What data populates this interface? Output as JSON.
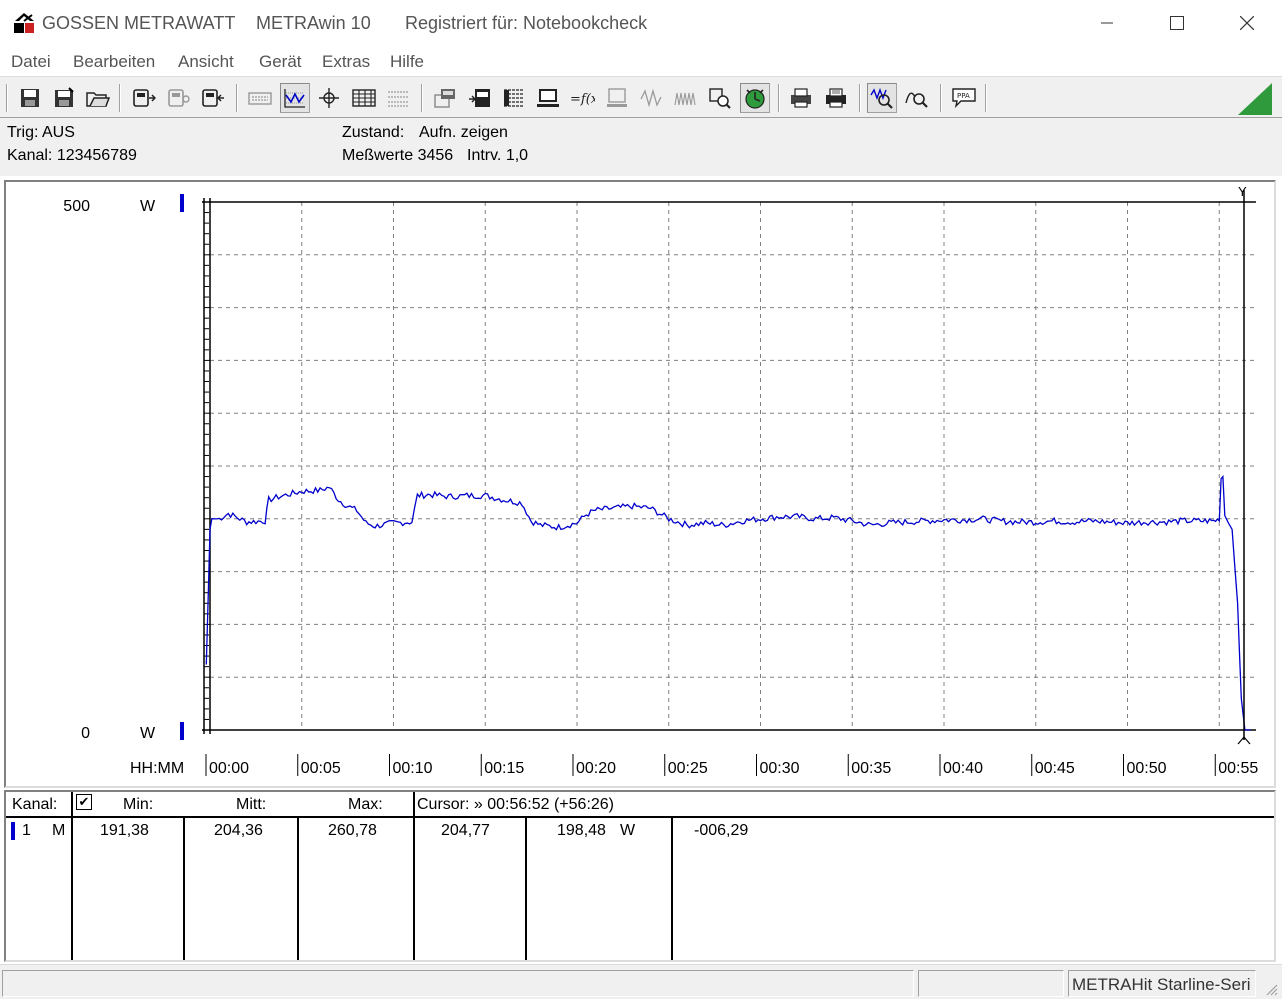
{
  "titlebar": {
    "company": "GOSSEN METRAWATT",
    "app": "METRAwin 10",
    "registered": "Registriert für: Notebookcheck"
  },
  "menu": [
    "Datei",
    "Bearbeiten",
    "Ansicht",
    "Gerät",
    "Extras",
    "Hilfe"
  ],
  "toolbar": {
    "icons": [
      "save-icon",
      "save-as-icon",
      "open-icon",
      "device-read-icon",
      "device-config-icon",
      "device-send-icon",
      "keyboard-icon",
      "waveform-view-icon",
      "cursor-crosshair-icon",
      "table-view-icon",
      "list-view-icon",
      "multimeter-icon",
      "record-icon",
      "data-grid-icon",
      "computer-icon",
      "formula-icon",
      "monitor-icon",
      "signal-icon",
      "signal-noise-icon",
      "search-device-icon",
      "trigger-icon",
      "print-preview-icon",
      "print-icon",
      "zoom-wave-icon",
      "zoom-curve-icon",
      "comment-icon"
    ]
  },
  "info": {
    "trig": "Trig: AUS",
    "kanal": "Kanal: 123456789",
    "zustand_label": "Zustand:",
    "zustand_value": "Aufn. zeigen",
    "messwerte": "Meßwerte 3456",
    "intrv": "Intrv. 1,0"
  },
  "chart_data": {
    "type": "line",
    "y_top_label": "500",
    "y_bottom_label": "0",
    "y_unit": "W",
    "ylim": [
      0,
      500
    ],
    "x_axis_label": "HH:MM",
    "x_tick_labels": [
      "00:00",
      "00:05",
      "00:10",
      "00:15",
      "00:20",
      "00:25",
      "00:30",
      "00:35",
      "00:40",
      "00:45",
      "00:50",
      "00:55"
    ],
    "x_ticks_minutes": [
      0,
      5,
      10,
      15,
      20,
      25,
      30,
      35,
      40,
      45,
      50,
      55
    ],
    "xlim_minutes": [
      0,
      57
    ],
    "grid": true,
    "series_color": "#0000cc",
    "series": [
      {
        "x_minutes": [
          -0.2,
          0.0,
          0.1,
          0.5,
          1.0,
          2.0,
          3.0,
          3.2,
          4.0,
          5.0,
          6.0,
          6.5,
          7.0,
          7.5,
          8.0,
          8.5,
          9.0,
          10.0,
          11.0,
          11.3,
          12.0,
          13.0,
          14.0,
          15.0,
          16.0,
          17.0,
          17.5,
          18.0,
          19.0,
          20.0,
          20.5,
          21.0,
          22.0,
          23.0,
          24.0,
          25.0,
          26.0,
          27.0,
          28.0,
          29.0,
          30.0,
          31.0,
          32.0,
          33.0,
          34.0,
          35.0,
          36.0,
          37.0,
          38.0,
          39.0,
          40.0,
          41.0,
          42.0,
          43.0,
          44.0,
          45.0,
          46.0,
          47.0,
          48.0,
          49.0,
          50.0,
          51.0,
          52.0,
          53.0,
          54.0,
          54.7,
          54.9,
          55.0,
          55.1,
          55.2,
          55.3,
          55.5,
          55.7,
          56.0,
          56.2,
          56.4,
          56.7
        ],
        "y_watts": [
          62,
          190,
          200,
          200,
          205,
          197,
          198,
          218,
          222,
          226,
          227,
          230,
          218,
          212,
          208,
          196,
          193,
          196,
          197,
          222,
          223,
          221,
          222,
          222,
          218,
          215,
          198,
          194,
          192,
          196,
          204,
          208,
          210,
          212,
          210,
          200,
          194,
          196,
          194,
          198,
          200,
          202,
          202,
          200,
          201,
          198,
          194,
          196,
          197,
          198,
          199,
          199,
          200,
          198,
          197,
          197,
          198,
          197,
          198,
          197,
          196,
          197,
          197,
          198,
          198,
          198,
          199,
          198,
          238,
          240,
          203,
          196,
          190,
          120,
          30,
          0,
          0
        ]
      }
    ]
  },
  "cursor_marker": "Y",
  "table": {
    "headers": {
      "kanal": "Kanal:",
      "check": "✔",
      "min": "Min:",
      "mitt": "Mitt:",
      "max": "Max:",
      "cursor": "Cursor: » 00:56:52 (+56:26)"
    },
    "row": {
      "channel": "1",
      "mode": "M",
      "min": "191,38",
      "mitt": "204,36",
      "max": "260,78",
      "cursor_a": "204,77",
      "cursor_b": "198,48",
      "unit": "W",
      "delta": "-006,29"
    }
  },
  "statusbar": {
    "device": "METRAHit Starline-Seri"
  },
  "colors": {
    "series": "#0000cc",
    "channel_marker": "#0000cc",
    "grid": "#808080",
    "accent_green": "#2e9a3c"
  }
}
